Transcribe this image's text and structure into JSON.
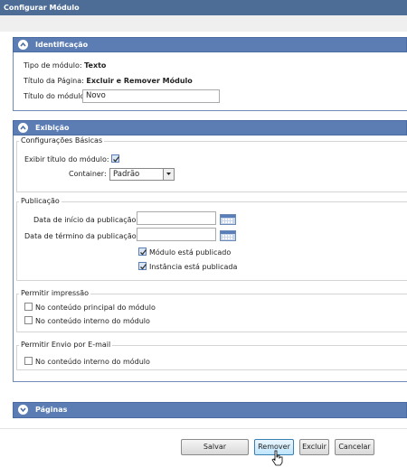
{
  "window": {
    "title": "Configurar Módulo"
  },
  "identificacao": {
    "header": "Identificação",
    "tipo_label": "Tipo de módulo:",
    "tipo_value": "Texto",
    "titulo_pagina_label": "Título da Página:",
    "titulo_pagina_value": "Excluir e Remover Módulo",
    "titulo_modulo_label": "Título do módulo:",
    "titulo_modulo_value": "Novo"
  },
  "exibicao": {
    "header": "Exibição",
    "basicas_legend": "Configurações Básicas",
    "exibir_titulo_label": "Exibir título do módulo:",
    "exibir_titulo_checked": true,
    "container_label": "Container:",
    "container_value": "Padrão",
    "publicacao_legend": "Publicação",
    "data_inicio_label": "Data de início da publicação:",
    "data_inicio_value": "",
    "data_termino_label": "Data de término da publicação:",
    "data_termino_value": "",
    "modulo_publicado_label": "Módulo está publicado",
    "instancia_publicada_label": "Instância está publicada",
    "impressao_legend": "Permitir impressão",
    "impressao_principal_label": "No conteúdo principal do módulo",
    "impressao_interno_label": "No conteúdo interno do módulo",
    "email_legend": "Permitir Envio por E-mail",
    "email_interno_label": "No conteúdo interno do módulo"
  },
  "paginas": {
    "header": "Páginas"
  },
  "buttons": {
    "salvar": "Salvar",
    "remover": "Remover",
    "excluir": "Excluir",
    "cancelar": "Cancelar"
  },
  "colors": {
    "titlebar": "#4d6c96",
    "panel_header": "#5b7db3",
    "button_hover": "#bee6fd"
  }
}
